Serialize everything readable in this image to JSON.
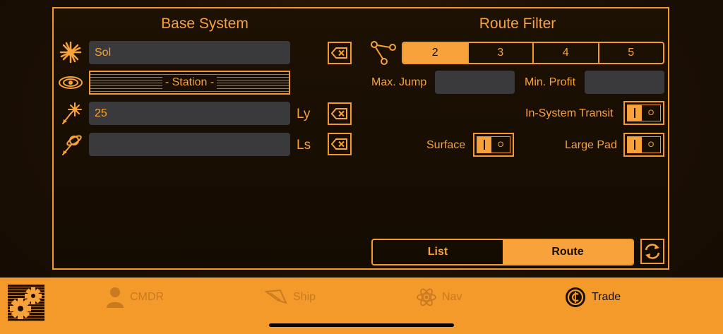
{
  "base_system": {
    "heading": "Base System",
    "system_value": "Sol",
    "station_label": "- Station -",
    "distance_value": "25",
    "distance_unit": "Ly",
    "arrival_value": "",
    "arrival_unit": "Ls"
  },
  "route_filter": {
    "heading": "Route Filter",
    "hops": [
      "2",
      "3",
      "4",
      "5"
    ],
    "selected_hops": "2",
    "max_jump_label": "Max. Jump",
    "max_jump_value": "",
    "min_profit_label": "Min. Profit",
    "min_profit_value": "",
    "in_system_transit_label": "In-System Transit",
    "surface_label": "Surface",
    "large_pad_label": "Large Pad",
    "toggle_off_text": "O"
  },
  "view_toggle": {
    "list_label": "List",
    "route_label": "Route",
    "selected": "Route"
  },
  "tabs": [
    {
      "label": "CMDR",
      "icon": "person-icon"
    },
    {
      "label": "Ship",
      "icon": "ship-icon"
    },
    {
      "label": "Nav",
      "icon": "atom-icon"
    },
    {
      "label": "Trade",
      "icon": "credits-icon"
    }
  ],
  "active_tab": "Trade",
  "colors": {
    "accent": "#f7a23a",
    "field_bg": "#3a3a3c",
    "panel_bg": "#1a0f02"
  }
}
